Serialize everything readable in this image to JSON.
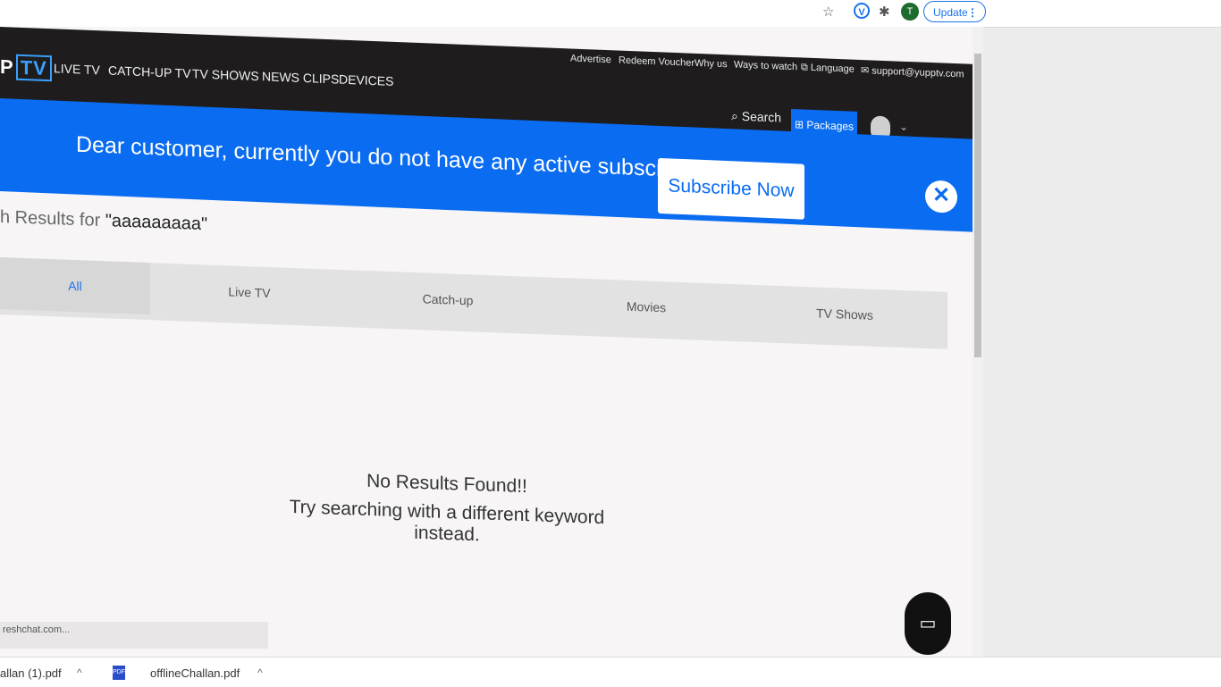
{
  "browser": {
    "update_label": "Update",
    "profile_initial": "T",
    "ext_v": "V"
  },
  "header": {
    "logo_left": "P",
    "logo_tv": "TV",
    "top_links": [
      "Advertise",
      "Redeem Voucher",
      "Why us",
      "Ways to watch",
      "Language",
      "support@yupptv.com"
    ],
    "nav": [
      "LIVE TV",
      "CATCH-UP TV",
      "TV SHOWS",
      "NEWS CLIPS",
      "DEVICES"
    ],
    "search_label": "Search",
    "packages_label": "Packages"
  },
  "banner": {
    "message": "Dear customer, currently you do not have any active subscriptions",
    "subscribe_label": "Subscribe Now",
    "close_glyph": "✕"
  },
  "results": {
    "prefix": "h Results for ",
    "query": "\"aaaaaaaaa\"",
    "tabs": [
      "All",
      "Live TV",
      "Catch-up",
      "Movies",
      "TV Shows"
    ],
    "active_tab": "All",
    "empty_line1": "No Results Found!!",
    "empty_line2": "Try searching with a different keyword instead."
  },
  "status_url": "reshchat.com...",
  "downloads": [
    {
      "name": "allan (1).pdf"
    },
    {
      "name": "offlineChallan.pdf"
    }
  ],
  "colors": {
    "accent": "#0a6cf0",
    "header_bg": "#1e1c1c"
  }
}
